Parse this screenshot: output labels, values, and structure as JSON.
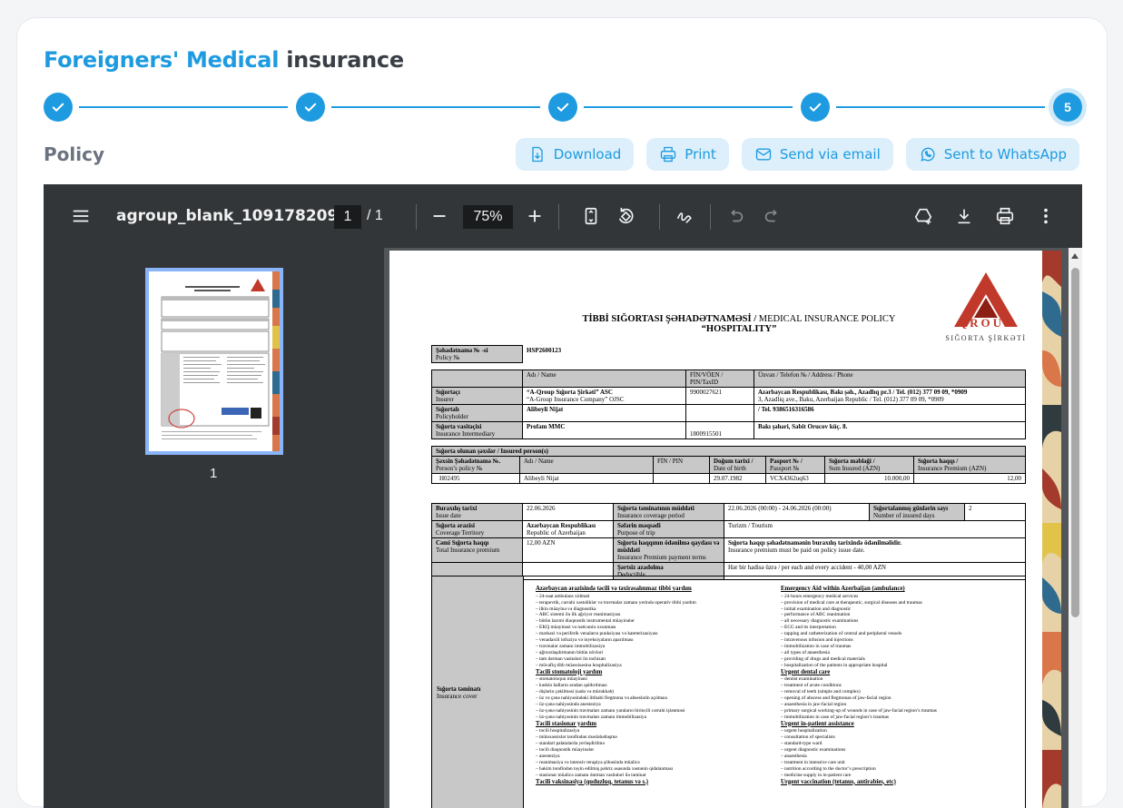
{
  "header": {
    "title_highlight": "Foreigners' Medical",
    "title_rest": "insurance"
  },
  "stepper": {
    "current_step": "5",
    "total_steps": 5,
    "completed_steps": 4
  },
  "section": {
    "label": "Policy"
  },
  "actions": {
    "download": "Download",
    "print": "Print",
    "email": "Send via email",
    "whatsapp": "Sent to WhatsApp"
  },
  "viewer": {
    "filename": "agroup_blank_109178209...",
    "page_current": "1",
    "page_total": "/  1",
    "zoom": "75%",
    "thumbnail_page": "1"
  },
  "colors": {
    "accent": "#1e9be0",
    "accent_light": "#dceffb",
    "viewer_bg": "#323639"
  },
  "document": {
    "title_line1_bold": "TİBBİ SIĞORTASI ŞƏHADƏTNAMƏSİ /",
    "title_line1_rest": " MEDICAL INSURANCE POLICY",
    "title_line2": "“HOSPITALITY”",
    "logo_text": "QROUP",
    "logo_sub": "SIĞORTA ŞİRKƏTİ",
    "policy_no_label": "Şəhadətnamə № -si",
    "policy_no_label_en": "Policy №",
    "policy_no": "HSP2600123",
    "parties": {
      "h_name": "Adı / Name",
      "h_fin": "FİN/VÖEN / PIN/TaxID",
      "h_address": "Ünvan / Telefon № / Address / Phone",
      "insurer_label": "Sığortaçı",
      "insurer_label_en": "Insurer",
      "insurer_name": "“A-Qroup Sığorta Şirkəti” ASC",
      "insurer_name_en": "“A-Group Insurance Company” OJSC",
      "insurer_fin": "9900027621",
      "insurer_address": "Azərbaycan Respublikası, Bakı şəh., Azadlıq pr.3 / Tel. (012) 377 09 09, *0909",
      "insurer_address_en": "3, Azadliq ave., Baku, Azerbaijan Republic / Tel. (012) 377 09 09, *0909",
      "holder_label": "Sığortalı",
      "holder_label_en": "Policyholder",
      "holder_name": "Alibeyli Nijat",
      "holder_phone": "/ Tel. 9386516316586",
      "intermediary_label": "Sığorta vasitəçisi",
      "intermediary_label_en": "Insurance Intermediary",
      "intermediary_name": "Profam MMC",
      "intermediary_fin": "1800915501",
      "intermediary_address": "Bakı şəhəri, Sabit Orucov küç. 8."
    },
    "insured": {
      "header": "Sığorta olunan şəxslər / Insured person(s)",
      "h_policy": "Şəxsin Şəhadətnamə №.",
      "h_policy_en": "Person’s policy №",
      "h_name": "Adı / Name",
      "h_fin": "FİN / PIN",
      "h_dob": "Doğum tarixi /",
      "h_dob_en": "Date of birth",
      "h_passport": "Pasport № /",
      "h_passport_en": "Passport №",
      "h_sum": "Sığorta məbləği /",
      "h_sum_en": "Sum Insured (AZN)",
      "h_premium": "Sığorta haqqı /",
      "h_premium_en": "Insurance Premium (AZN)",
      "row_policy": "H02495",
      "row_name": "Alibeyli Nijat",
      "row_fin": "",
      "row_dob": "29.07.1982",
      "row_passport": "VCX4362uq63",
      "row_sum": "10.000,00",
      "row_premium": "12,00"
    },
    "terms": {
      "issue_label": "Buraxılış tarixi",
      "issue_label_en": "Issue date",
      "issue_date": "22.06.2026",
      "period_label": "Sığorta təminatının müddəti",
      "period_label_en": "Insurance coverage period",
      "period": "22.06.2026 (00:00) - 24.06.2026 (00:00)",
      "days_label": "Sığortalanmış günlərin sayı",
      "days_label_en": "Number of insured days",
      "days": "2",
      "territory_label": "Sığorta ərazisi",
      "territory_label_en": "Coverage Territory",
      "territory": "Azərbaycan Respublikası",
      "territory_en": "Republic of Azerbaijan",
      "purpose_label": "Səfərin məqsədi",
      "purpose_label_en": "Purpose of trip",
      "purpose": "Turizm / Tourism",
      "total_label": "Cəmi Sığorta haqqı",
      "total_label_en": "Total Insurance premium",
      "total": "12,00 AZN",
      "payment_label": "Sığorta haqqının ödənilmə qaydası və müddəti",
      "payment_label_en": "Insurance Premium payment terms",
      "payment": "Sığorta haqqı şəhadətnamənin buraxılış tarixində ödənilməlidir.",
      "payment_en": "Insurance premium must be paid on policy issue date.",
      "deductible_label": "Şərtsiz azadolma",
      "deductible_label_en": "Deductible",
      "deductible": "Hər bir hadisə üzrə / per each and every accident - 40,00 AZN"
    },
    "coverage": {
      "label": "Sığorta təminatı",
      "label_en": "Insurance cover",
      "az_sections": [
        {
          "title": "Azərbaycan ərazisində təcili və təxirəsalınmaz tibbi yardım",
          "items": [
            "– 24-saat ambulans xidməti",
            "– terapevtik, cərrahi xəstəliklər və travmalar zamanı yerində operativ tibbi yardım",
            "– ilkin müayinə və diagnostika",
            "– ABC sistemi ilə ilk ağciyər reanimasiyası",
            "– bütün lazımi diaqnostik instrumental müayinələr",
            "– EKQ müayinəsi və nəticənin oxunması",
            "– mərkəzi və periferik venaların punksiyası və kateterizasiyası",
            "– venadaxili infuziya və inyeksiyaların aparılması",
            "– travmalar zamanı immobilizasiya",
            "– ağrısızlaşdırmanın bütün növləri",
            "– tam dərman vasitələri ilə təchizatı",
            "– müvafiq tibb müəssisəsinə hospitalizasiya"
          ]
        },
        {
          "title": "Təcili stomatoloji yardım",
          "items": [
            "– stomatoloqun müayinəsi",
            "– kəskin halların aradan qaldırılması",
            "– dişlərin çəkilməsi (sadə və mürəkkəb)",
            "– üz və çənə nahiyəsindəki iltihabi flegmona və abseslərin açılması",
            "– üz-çənə nahiyəsində anesteziya",
            "– üz-çənə nahiyəsinin travmaları zamanı yaraların birincili cərrahi işlənməsi",
            "– üz-çənə nahiyəsinin travmaları zamanı immobilizasiya"
          ]
        },
        {
          "title": "Təcili stasionar yardım",
          "items": [
            "– təcili hospitalizasiya",
            "– mütəxəssislər tərəfindən məsləhətləşmə",
            "– standart palatalarda yerləşdirilmə",
            "– təcili diaqnostik müayinələr",
            "– anesteziya",
            "– reanimasiya və intensiv terapiya şöbəsində müalicə",
            "– həkim tərəfindən təyin edilmiş pəhriz əsasında xəstənin qidalanması",
            "– stasionar müalicə zamanı dərman vasitələri ilə təminat"
          ]
        }
      ],
      "en_sections": [
        {
          "title": "Emergency Aid within Azerbaijan (ambulance)",
          "items": [
            "– 24-hours emergency medical services",
            "– provision of medical care at therapeutic, surgical diseases and traumas",
            "– initial examination and diagnostic",
            "– performance of ABC reanimation",
            "– all necessary diagnostic examinations",
            "– ECG and its interpretation",
            "– tapping and catheterization of central and peripheral vessels",
            "– intravenous infusion and injections",
            "– immobilization in case of traumas",
            "– all types of anaesthesia",
            "– providing of drugs and medical materials",
            "– hospitalization of the patients in appropriate hospital"
          ]
        },
        {
          "title": "Urgent dental care",
          "items": [
            "– dentist examination",
            "– treatment of acute conditions",
            "– removal of teeth (simple and complex)",
            "– opening of abscess and flegmonas of jaw-facial region",
            "– anaesthesia in jaw-facial region",
            "– primary surgical working-up of wounds in case of jaw-facial region’s traumas",
            "– immobilization in case of jaw-facial region’s traumas"
          ]
        },
        {
          "title": "Urgent in-patient assistance",
          "items": [
            "– urgent hospitalization",
            "– consultation of specialists",
            "– standard-type ward",
            "– urgent diagnostic examinations",
            "– anaesthesia",
            "– treatment in intensive care unit",
            "– nutrition according to the doctor’s prescription",
            "– medicine supply in in-patient care"
          ]
        }
      ],
      "az_cut_title": "Təcili vaksinasiya (quduzluq, tetanus və s.)",
      "en_cut_title": "Urgent vaccination (tetanus, antirabies, etc)"
    }
  }
}
